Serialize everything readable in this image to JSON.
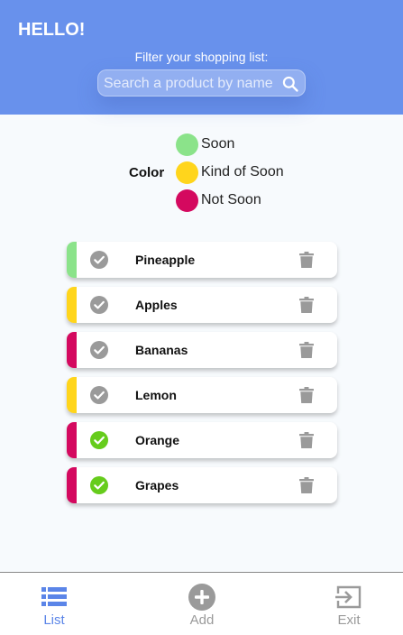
{
  "header": {
    "greeting": "HELLO!",
    "filter_label": "Filter your shopping list:",
    "search_placeholder": "Search a product by name",
    "background_color": "#6891ec"
  },
  "legend": {
    "title": "Color",
    "items": [
      {
        "label": "Soon",
        "color": "#8be38a"
      },
      {
        "label": "Kind of Soon",
        "color": "#ffd51c"
      },
      {
        "label": "Not Soon",
        "color": "#d4095f"
      }
    ]
  },
  "items": [
    {
      "name": "Pineapple",
      "color": "#8be38a",
      "checked": false
    },
    {
      "name": "Apples",
      "color": "#ffd51c",
      "checked": false
    },
    {
      "name": "Bananas",
      "color": "#d4095f",
      "checked": false
    },
    {
      "name": "Lemon",
      "color": "#ffd51c",
      "checked": false
    },
    {
      "name": "Orange",
      "color": "#d4095f",
      "checked": true
    },
    {
      "name": "Grapes",
      "color": "#d4095f",
      "checked": true
    }
  ],
  "nav": {
    "list_label": "List",
    "add_label": "Add",
    "exit_label": "Exit",
    "active_color": "#5b85e8",
    "inactive_color": "#9a9a9a"
  }
}
